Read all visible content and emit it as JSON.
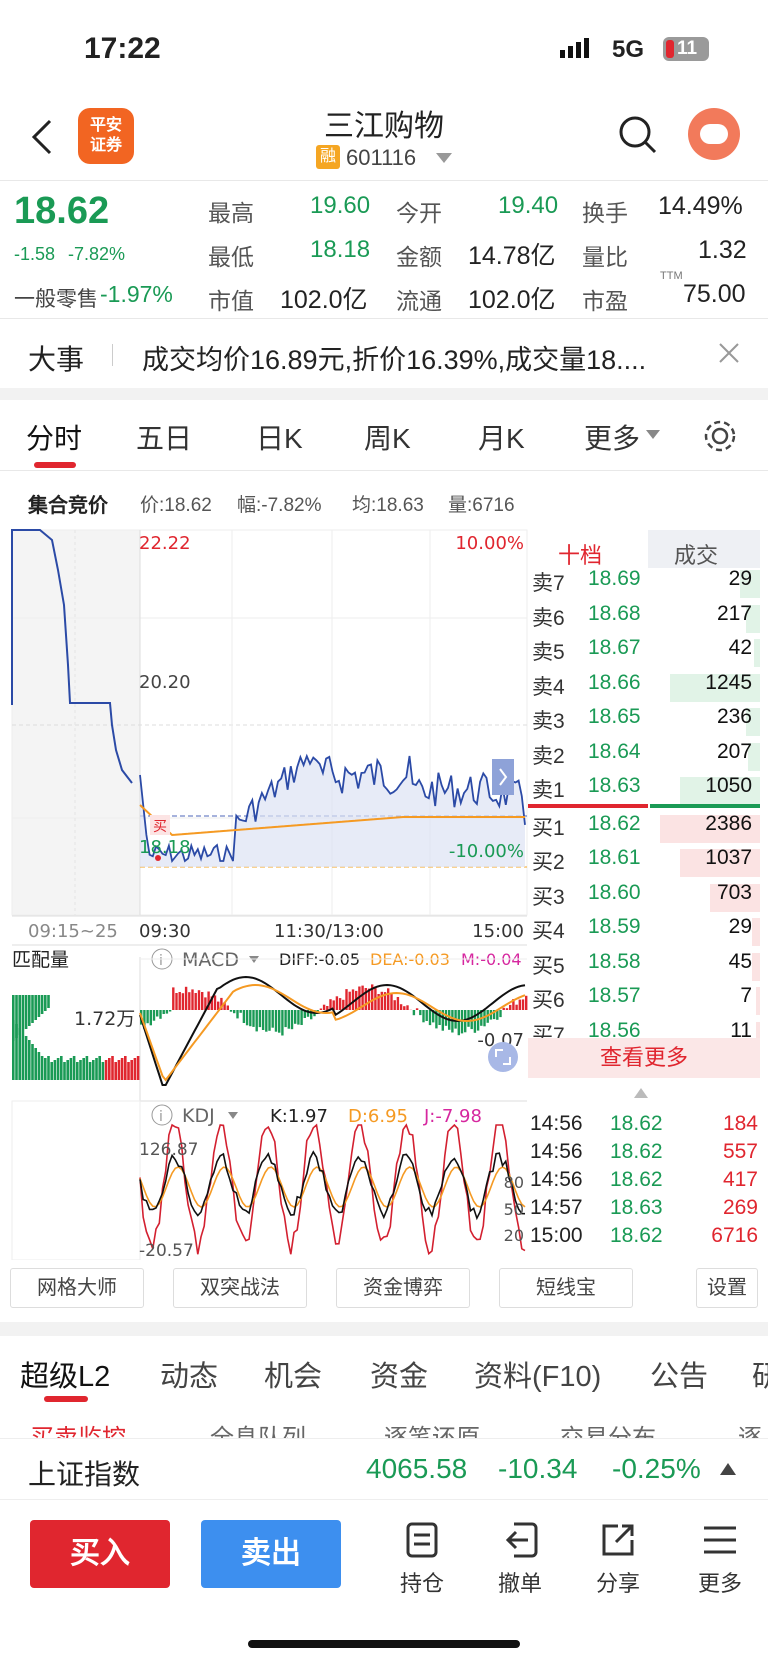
{
  "status_bar": {
    "time": "17:22",
    "network": "5G",
    "battery": "11"
  },
  "header": {
    "title": "三江购物",
    "badge": "融",
    "code": "601116",
    "logo_text_1": "平安",
    "logo_text_2": "证券"
  },
  "quote": {
    "price": "18.62",
    "change": "-1.58",
    "change_pct": "-7.82%",
    "sector_label": "一般零售",
    "sector_pct": "-1.97%",
    "high_label": "最高",
    "high": "19.60",
    "low_label": "最低",
    "low": "18.18",
    "mcap_label": "市值",
    "mcap": "102.0亿",
    "open_label": "今开",
    "open": "19.40",
    "amount_label": "金额",
    "amount": "14.78亿",
    "float_label": "流通",
    "float": "102.0亿",
    "turnover_label": "换手",
    "turnover": "14.49%",
    "vr_label": "量比",
    "vr": "1.32",
    "pe_label": "市盈",
    "pe_sup": "TTM",
    "pe": "75.00"
  },
  "news": {
    "label": "大事",
    "text": "成交均价16.89元,折价16.39%,成交量18...."
  },
  "chart_tabs": [
    "分时",
    "五日",
    "日K",
    "周K",
    "月K",
    "更多"
  ],
  "auction": {
    "label": "集合竞价",
    "price": "价:18.62",
    "amp": "幅:-7.82%",
    "avg": "均:18.63",
    "vol": "量:6716"
  },
  "price_axis": {
    "top": "22.22",
    "mid": "20.20",
    "bottom": "18.18",
    "top_pct": "10.00%",
    "bottom_pct": "-10.00%"
  },
  "time_axis": {
    "pre": "09:15~25",
    "open": "09:30",
    "mid": "11:30/13:00",
    "close": "15:00"
  },
  "macd": {
    "match_label": "匹配量",
    "match_val": "1.72万",
    "name": "MACD",
    "diff": "DIFF:-0.05",
    "dea": "DEA:-0.03",
    "m": "M:-0.04",
    "right_val": "-0.07"
  },
  "kdj": {
    "name": "KDJ",
    "k": "K:1.97",
    "d": "D:6.95",
    "j": "J:-7.98",
    "top": "126.87",
    "bottom": "-20.57",
    "r80": "80",
    "r50": "50",
    "r20": "20"
  },
  "orderbook": {
    "tab_1": "十档",
    "tab_2": "成交",
    "rows": [
      {
        "name": "卖7",
        "price": "18.69",
        "vol": "29"
      },
      {
        "name": "卖6",
        "price": "18.68",
        "vol": "217"
      },
      {
        "name": "卖5",
        "price": "18.67",
        "vol": "42"
      },
      {
        "name": "卖4",
        "price": "18.66",
        "vol": "1245"
      },
      {
        "name": "卖3",
        "price": "18.65",
        "vol": "236"
      },
      {
        "name": "卖2",
        "price": "18.64",
        "vol": "207"
      },
      {
        "name": "卖1",
        "price": "18.63",
        "vol": "1050"
      },
      {
        "name": "买1",
        "price": "18.62",
        "vol": "2386"
      },
      {
        "name": "买2",
        "price": "18.61",
        "vol": "1037"
      },
      {
        "name": "买3",
        "price": "18.60",
        "vol": "703"
      },
      {
        "name": "买4",
        "price": "18.59",
        "vol": "29"
      },
      {
        "name": "买5",
        "price": "18.58",
        "vol": "45"
      },
      {
        "name": "买6",
        "price": "18.57",
        "vol": "7"
      },
      {
        "name": "买7",
        "price": "18.56",
        "vol": "11"
      }
    ],
    "more": "查看更多"
  },
  "trades": [
    {
      "t": "14:56",
      "p": "18.62",
      "v": "184"
    },
    {
      "t": "14:56",
      "p": "18.62",
      "v": "557"
    },
    {
      "t": "14:56",
      "p": "18.62",
      "v": "417"
    },
    {
      "t": "14:57",
      "p": "18.63",
      "v": "269"
    },
    {
      "t": "15:00",
      "p": "18.62",
      "v": "6716"
    }
  ],
  "tools": [
    "网格大师",
    "双突战法",
    "资金博弈",
    "短线宝",
    "设置"
  ],
  "footer_tabs": [
    "超级L2",
    "动态",
    "机会",
    "资金",
    "资料(F10)",
    "公告",
    "研"
  ],
  "sub_tabs": [
    "买卖监控",
    "全息队列",
    "逐笔还原",
    "交易分布",
    "逐"
  ],
  "index": {
    "name": "上证指数",
    "value": "4065.58",
    "change": "-10.34",
    "pct": "-0.25%"
  },
  "actions": {
    "buy": "买入",
    "sell": "卖出",
    "hold": "持仓",
    "cancel": "撤单",
    "share": "分享",
    "more": "更多"
  },
  "buy_marker": "买"
}
